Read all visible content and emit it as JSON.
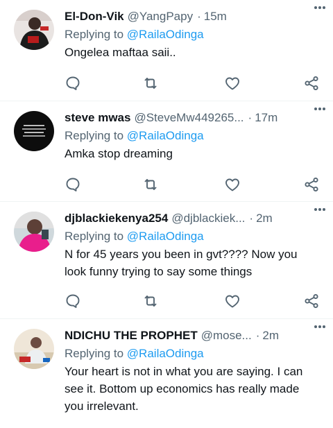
{
  "tweets": [
    {
      "name": "El-Don-Vik",
      "handle": "@YangPapy",
      "time": "15m",
      "replying_prefix": "Replying to",
      "replying_to": "@RailaOdinga",
      "text": "Ongelea maftaa saii.."
    },
    {
      "name": "steve mwas",
      "handle": "@SteveMw449265...",
      "time": "17m",
      "replying_prefix": "Replying to",
      "replying_to": "@RailaOdinga",
      "text": "Amka stop dreaming"
    },
    {
      "name": "djblackiekenya254",
      "handle": "@djblackiek...",
      "time": "2m",
      "replying_prefix": "Replying to",
      "replying_to": "@RailaOdinga",
      "text": "N for 45 years you been in gvt???? Now you look funny trying to say some things"
    },
    {
      "name": "NDICHU THE PROPHET",
      "handle": "@mose...",
      "time": "2m",
      "replying_prefix": "Replying to",
      "replying_to": "@RailaOdinga",
      "text": "Your heart is not in what you are saying. I can see it. Bottom up economics has really made you irrelevant."
    }
  ],
  "icons": {
    "more": "more-horizontal-icon",
    "reply": "reply-bubble-icon",
    "retweet": "retweet-icon",
    "like": "heart-icon",
    "share": "share-nodes-icon"
  },
  "colors": {
    "mention": "#1d9bf0",
    "secondary_text": "#536471",
    "icon": "#536471",
    "divider": "#eff3f4"
  }
}
